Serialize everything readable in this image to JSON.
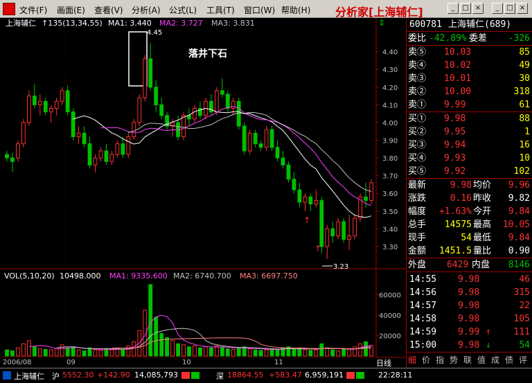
{
  "menu": {
    "items": [
      "文件(F)",
      "画面(E)",
      "查看(V)",
      "分析(A)",
      "公式(L)",
      "工具(T)",
      "窗口(W)",
      "帮助(H)"
    ],
    "brand": "分析家",
    "brand_suffix": "[上海辅仁]",
    "window_buttons": [
      "_",
      "□",
      "×"
    ]
  },
  "chart": {
    "stock_name": "上海辅仁",
    "ma_label": "↑135(13,34,55)",
    "ma1_label": "MA1: 3.440",
    "ma2_label": "MA2: 3.727",
    "ma3_label": "MA3: 3.831",
    "annotation": "落井下石",
    "high_label": "4.45",
    "low_label": "3.23",
    "vol_label": "VOL(5,10,20)",
    "vol_value": "10498.000",
    "vol_ma1": "MA1: 9335.600",
    "vol_ma2": "MA2: 6740.700",
    "vol_ma3": "MA3: 6697.750",
    "date_labels": [
      "2006/08",
      "09",
      "10",
      "11"
    ],
    "colors": {
      "up": "#ff3030",
      "down": "#00c000",
      "ma1": "#ffffff",
      "ma2": "#ff40ff",
      "ma3": "#c0c0c0",
      "axis": "#a00000"
    }
  },
  "chart_data": {
    "type": "candlestick",
    "price_axis": [
      4.4,
      4.3,
      4.2,
      4.1,
      4.0,
      3.9,
      3.8,
      3.7,
      3.6,
      3.5,
      3.4,
      3.3
    ],
    "volume_axis": [
      60000,
      40000,
      20000
    ],
    "ylim": [
      3.19,
      4.52
    ],
    "vol_max": 72000,
    "candles": [
      [
        3.82,
        3.84,
        3.78,
        3.8
      ],
      [
        3.8,
        3.83,
        3.72,
        3.78
      ],
      [
        3.8,
        3.9,
        3.78,
        3.88
      ],
      [
        3.88,
        4.02,
        3.86,
        4.0
      ],
      [
        4.0,
        4.18,
        3.98,
        4.15
      ],
      [
        4.15,
        4.22,
        4.08,
        4.1
      ],
      [
        4.1,
        4.16,
        4.04,
        4.12
      ],
      [
        4.12,
        4.14,
        4.04,
        4.06
      ],
      [
        4.06,
        4.1,
        4.0,
        4.08
      ],
      [
        4.08,
        4.14,
        4.04,
        4.12
      ],
      [
        4.12,
        4.2,
        4.1,
        4.18
      ],
      [
        4.18,
        4.21,
        4.04,
        4.06
      ],
      [
        4.06,
        4.08,
        3.9,
        3.92
      ],
      [
        3.92,
        3.98,
        3.88,
        3.94
      ],
      [
        3.94,
        3.98,
        3.86,
        3.88
      ],
      [
        3.88,
        3.92,
        3.74,
        3.76
      ],
      [
        3.76,
        3.82,
        3.72,
        3.8
      ],
      [
        3.8,
        3.86,
        3.78,
        3.84
      ],
      [
        3.84,
        3.88,
        3.76,
        3.78
      ],
      [
        3.78,
        3.84,
        3.76,
        3.82
      ],
      [
        3.82,
        3.9,
        3.8,
        3.88
      ],
      [
        3.88,
        3.92,
        3.8,
        3.82
      ],
      [
        3.82,
        3.94,
        3.8,
        3.92
      ],
      [
        3.92,
        4.02,
        3.9,
        4.0
      ],
      [
        4.0,
        4.16,
        3.98,
        4.14
      ],
      [
        4.14,
        4.38,
        4.12,
        4.36
      ],
      [
        4.36,
        4.45,
        4.18,
        4.2
      ],
      [
        4.2,
        4.24,
        4.06,
        4.1
      ],
      [
        4.1,
        4.14,
        4.02,
        4.04
      ],
      [
        4.04,
        4.06,
        3.96,
        3.98
      ],
      [
        3.98,
        4.02,
        3.92,
        4.0
      ],
      [
        4.0,
        4.04,
        3.9,
        3.92
      ],
      [
        3.92,
        4.06,
        3.9,
        4.04
      ],
      [
        4.04,
        4.08,
        3.98,
        4.02
      ],
      [
        4.02,
        4.1,
        4.0,
        4.08
      ],
      [
        4.08,
        4.12,
        4.02,
        4.04
      ],
      [
        4.04,
        4.14,
        4.02,
        4.12
      ],
      [
        4.12,
        4.16,
        4.04,
        4.06
      ],
      [
        4.06,
        4.2,
        4.04,
        4.18
      ],
      [
        4.18,
        4.25,
        4.14,
        4.16
      ],
      [
        4.16,
        4.18,
        4.06,
        4.08
      ],
      [
        4.08,
        4.14,
        4.04,
        4.12
      ],
      [
        4.12,
        4.14,
        3.96,
        3.98
      ],
      [
        3.98,
        4.0,
        3.82,
        3.84
      ],
      [
        3.84,
        3.96,
        3.82,
        3.94
      ],
      [
        3.94,
        3.96,
        3.86,
        3.88
      ],
      [
        3.88,
        3.9,
        3.84,
        3.86
      ],
      [
        3.86,
        3.98,
        3.84,
        3.96
      ],
      [
        3.96,
        3.98,
        3.84,
        3.86
      ],
      [
        3.86,
        3.9,
        3.78,
        3.8
      ],
      [
        3.8,
        3.84,
        3.74,
        3.76
      ],
      [
        3.76,
        3.78,
        3.66,
        3.68
      ],
      [
        3.68,
        3.72,
        3.6,
        3.62
      ],
      [
        3.62,
        3.66,
        3.52,
        3.55
      ],
      [
        3.55,
        3.6,
        3.5,
        3.58
      ],
      [
        3.58,
        3.6,
        3.5,
        3.54
      ],
      [
        3.54,
        3.62,
        3.52,
        3.56
      ],
      [
        3.56,
        3.58,
        3.26,
        3.3
      ],
      [
        3.3,
        3.42,
        3.23,
        3.4
      ],
      [
        3.4,
        3.44,
        3.32,
        3.36
      ],
      [
        3.36,
        3.46,
        3.34,
        3.44
      ],
      [
        3.44,
        3.46,
        3.32,
        3.34
      ],
      [
        3.34,
        3.48,
        3.28,
        3.36
      ],
      [
        3.36,
        3.48,
        3.34,
        3.46
      ],
      [
        3.46,
        3.6,
        3.44,
        3.58
      ],
      [
        3.58,
        3.66,
        3.52,
        3.56
      ],
      [
        3.56,
        3.68,
        3.54,
        3.66
      ]
    ],
    "volumes": [
      6000,
      5000,
      8000,
      12000,
      15000,
      9000,
      7000,
      6500,
      6000,
      7000,
      11000,
      8000,
      9000,
      6000,
      5000,
      8000,
      6000,
      5500,
      7000,
      6000,
      8000,
      6500,
      10000,
      14000,
      25000,
      45000,
      70000,
      38000,
      22000,
      18000,
      15000,
      12000,
      11000,
      9000,
      10000,
      8000,
      9000,
      8000,
      10000,
      9000,
      7000,
      6500,
      8000,
      9000,
      7000,
      6000,
      5500,
      6000,
      7000,
      6500,
      8000,
      9000,
      7000,
      8000,
      6000,
      5500,
      6000,
      12000,
      8000,
      6000,
      5000,
      6500,
      7000,
      9000,
      12000,
      14000,
      10498
    ]
  },
  "quote": {
    "code": "600781",
    "name": "上海辅仁(689)",
    "wb_label": "委比",
    "wb_value": "-42.89%",
    "wc_label": "委差",
    "wc_value": "-326",
    "sell": [
      {
        "label": "卖⑤",
        "price": "10.03",
        "vol": "85"
      },
      {
        "label": "卖④",
        "price": "10.02",
        "vol": "49"
      },
      {
        "label": "卖③",
        "price": "10.01",
        "vol": "30"
      },
      {
        "label": "卖②",
        "price": "10.00",
        "vol": "318"
      },
      {
        "label": "卖①",
        "price": "9.99",
        "vol": "61"
      }
    ],
    "buy": [
      {
        "label": "买①",
        "price": "9.98",
        "vol": "88"
      },
      {
        "label": "买②",
        "price": "9.95",
        "vol": "1"
      },
      {
        "label": "买③",
        "price": "9.94",
        "vol": "16"
      },
      {
        "label": "买④",
        "price": "9.93",
        "vol": "10"
      },
      {
        "label": "买⑤",
        "price": "9.92",
        "vol": "102"
      }
    ],
    "stats": [
      {
        "l1": "最新",
        "v1": "9.98",
        "l2": "均价",
        "v2": "9.96"
      },
      {
        "l1": "涨跌",
        "v1": "0.16",
        "l2": "昨收",
        "v2": "9.82"
      },
      {
        "l1": "幅度",
        "v1": "+1.63%",
        "l2": "今开",
        "v2": "9.84"
      },
      {
        "l1": "总手",
        "v1": "14575",
        "l2": "最高",
        "v2": "10.05"
      },
      {
        "l1": "现手",
        "v1": "54",
        "l2": "最低",
        "v2": "9.84"
      },
      {
        "l1": "金额",
        "v1": "1451.5",
        "l2": "量比",
        "v2": "0.90"
      }
    ],
    "outer_label": "外盘",
    "outer_value": "6429",
    "inner_label": "内盘",
    "inner_value": "8146",
    "ticks": [
      {
        "time": "14:55",
        "price": "9.98",
        "arrow": "",
        "vol": "46"
      },
      {
        "time": "14:56",
        "price": "9.98",
        "arrow": "",
        "vol": "315"
      },
      {
        "time": "14:57",
        "price": "9.98",
        "arrow": "",
        "vol": "22"
      },
      {
        "time": "14:58",
        "price": "9.98",
        "arrow": "",
        "vol": "105"
      },
      {
        "time": "14:59",
        "price": "9.99",
        "arrow": "↑",
        "vol": "111"
      },
      {
        "time": "15:00",
        "price": "9.98",
        "arrow": "↓",
        "vol": "54"
      }
    ],
    "bottom_tabs": [
      "细",
      "价",
      "指",
      "势",
      "联",
      "值",
      "成",
      "债",
      "评"
    ]
  },
  "status": {
    "stock": "上海辅仁",
    "sh_label": "沪",
    "sh_index": "5552.30",
    "sh_change": "+142.90",
    "sh_volume": "14,085,793",
    "sz_label": "深",
    "sz_index": "18864.55",
    "sz_change": "+583.47",
    "sz_volume": "6,959,191",
    "time": "22:28:11",
    "view_mode": "日线"
  }
}
